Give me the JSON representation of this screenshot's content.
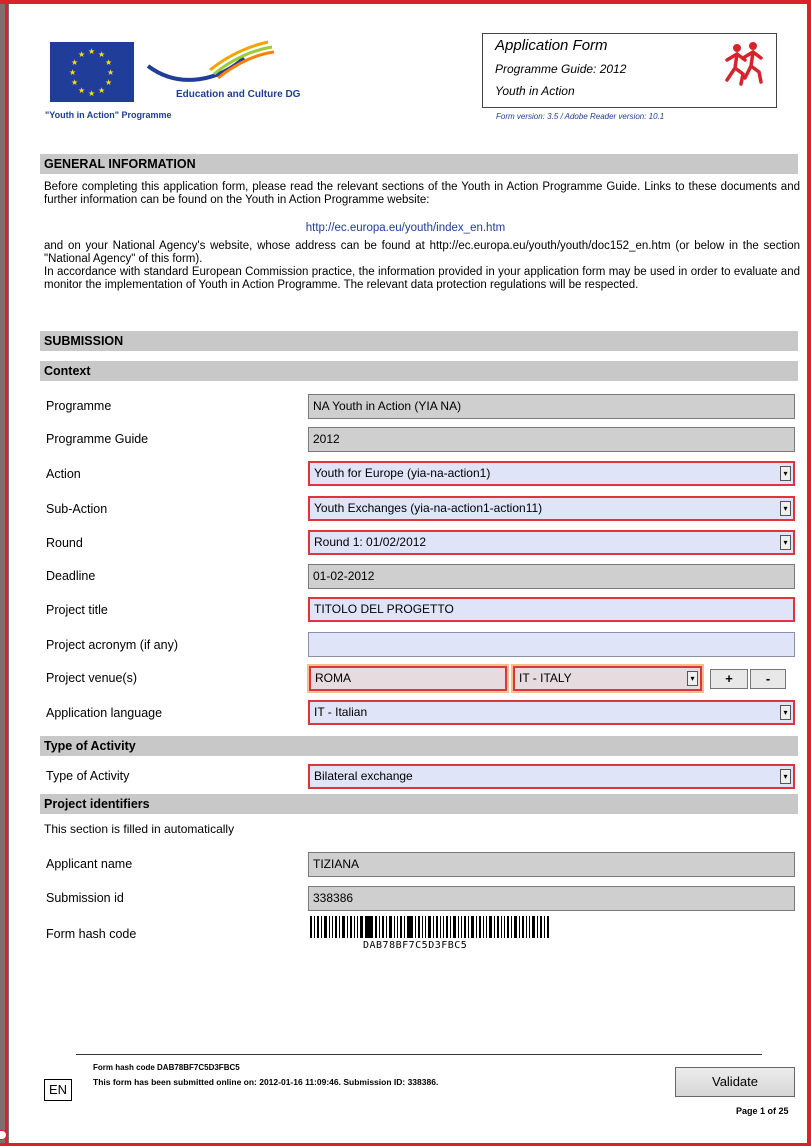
{
  "header": {
    "app_title": "Application Form",
    "guide": "Programme Guide: 2012",
    "programme": "Youth in Action",
    "form_version": "Form version: 3.5 / Adobe Reader version: 10.1",
    "eac": "Education and Culture DG",
    "yia": "\"Youth in Action\" Programme"
  },
  "general": {
    "heading": "GENERAL INFORMATION",
    "p1": "Before completing this application form, please read the relevant sections of the Youth in Action Programme Guide. Links to these documents and further information can be found on the Youth in Action Programme website:",
    "link": "http://ec.europa.eu/youth/index_en.htm",
    "p2": "and on your National Agency's website, whose address can be found at http://ec.europa.eu/youth/youth/doc152_en.htm (or below in the section \"National Agency\" of this form).",
    "p3": "In accordance with standard European Commission practice, the information provided in your application form may be used in order to evaluate and monitor the implementation of Youth in Action Programme. The relevant data protection regulations will be respected."
  },
  "sections": {
    "submission": "SUBMISSION",
    "context": "Context",
    "type_activity": "Type of Activity",
    "project_identifiers": "Project identifiers",
    "auto_note": "This section is filled in automatically"
  },
  "labels": {
    "programme": "Programme",
    "programme_guide": "Programme Guide",
    "action": "Action",
    "sub_action": "Sub-Action",
    "round": "Round",
    "deadline": "Deadline",
    "project_title": "Project title",
    "project_acronym": "Project acronym (if any)",
    "project_venue": "Project venue(s)",
    "application_language": "Application language",
    "type_of_activity": "Type of Activity",
    "applicant_name": "Applicant name",
    "submission_id": "Submission id",
    "form_hash_code": "Form hash code"
  },
  "values": {
    "programme": "NA Youth in Action (YIA NA)",
    "programme_guide": "2012",
    "action": "Youth for Europe (yia-na-action1)",
    "sub_action": "Youth Exchanges (yia-na-action1-action11)",
    "round": "Round 1: 01/02/2012",
    "deadline": "01-02-2012",
    "project_title": "TITOLO DEL PROGETTO",
    "project_acronym": "",
    "venue_city": "ROMA",
    "venue_country": "IT - ITALY",
    "application_language": "IT - Italian",
    "type_of_activity": "Bilateral exchange",
    "applicant_name": "TIZIANA",
    "submission_id": "338386",
    "hash_code": "DAB78BF7C5D3FBC5"
  },
  "buttons": {
    "plus": "+",
    "minus": "-",
    "dropdown": "▾",
    "validate": "Validate"
  },
  "footer": {
    "hash": "Form hash code DAB78BF7C5D3FBC5",
    "submitted": "This form has been submitted online on: 2012-01-16 11:09:46. Submission ID: 338386.",
    "lang": "EN",
    "page": "Page 1 of 25"
  },
  "colors": {
    "frame_red": "#d9232c",
    "eu_blue": "#1f3d99",
    "eu_yellow": "#ffe000",
    "section_grey": "#c8c8c8",
    "field_blue": "#dfe4f8"
  }
}
